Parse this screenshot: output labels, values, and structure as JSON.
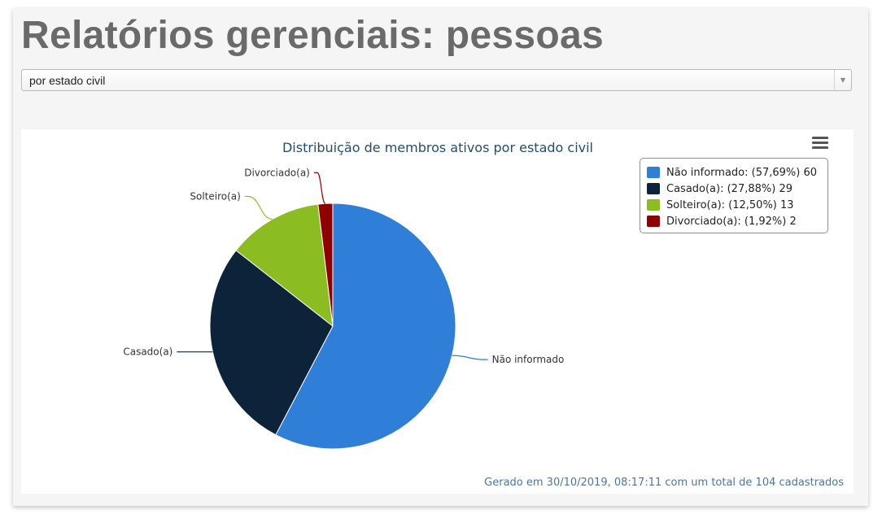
{
  "page": {
    "title": "Relatórios gerenciais: pessoas",
    "select_value": "por estado civil",
    "menu_icon": "hamburger-menu-icon",
    "dropdown_icon": "chevron-down-icon"
  },
  "chart_data": {
    "type": "pie",
    "title": "Distribuição de membros ativos por estado civil",
    "footer": "Gerado em 30/10/2019, 08:17:11 com um total de 104 cadastrados",
    "legend_position": "top-right",
    "series": [
      {
        "name": "Não informado",
        "value": 60,
        "percent": "57,69%",
        "color": "#2f7ed8"
      },
      {
        "name": "Casado(a)",
        "value": 29,
        "percent": "27,88%",
        "color": "#0d233a"
      },
      {
        "name": "Solteiro(a)",
        "value": 13,
        "percent": "12,50%",
        "color": "#8bbc21"
      },
      {
        "name": "Divorciado(a)",
        "value": 2,
        "percent": "1,92%",
        "color": "#910000"
      }
    ]
  }
}
